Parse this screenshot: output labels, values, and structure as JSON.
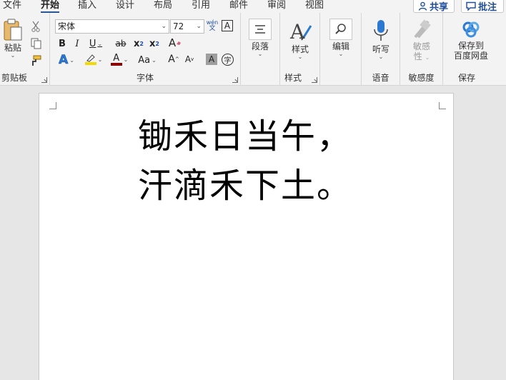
{
  "menu": {
    "tabs": [
      "文件",
      "开始",
      "插入",
      "设计",
      "布局",
      "引用",
      "邮件",
      "审阅",
      "视图"
    ],
    "share_label": "共享",
    "comment_label": "批注"
  },
  "ribbon": {
    "clipboard": {
      "paste_label": "粘贴",
      "group_label": "剪贴板"
    },
    "font": {
      "font_name": "宋体",
      "font_size": "72",
      "phonetic_top": "wén",
      "phonetic_bottom": "文",
      "border_char": "A",
      "clear_char": "A",
      "bold": "B",
      "italic": "I",
      "underline": "U",
      "strike": "ab",
      "subscript": "x",
      "subscript_mark": "2",
      "superscript": "x",
      "superscript_mark": "2",
      "text_effect": "A",
      "font_color": "A",
      "change_case": "Aa",
      "grow": "A",
      "shrink": "A",
      "shading": "A",
      "enclose": "字",
      "group_label": "字体"
    },
    "paragraph": {
      "label": "段落"
    },
    "styles": {
      "label": "样式",
      "group_label": "样式"
    },
    "editing": {
      "label": "编辑"
    },
    "voice": {
      "dictate_label": "听写",
      "group_label": "语音"
    },
    "sensitivity": {
      "label_line1": "敏感",
      "label_line2": "性",
      "group_label": "敏感度"
    },
    "save": {
      "label_line1": "保存到",
      "label_line2": "百度网盘",
      "group_label": "保存"
    }
  },
  "document": {
    "lines": [
      "锄禾日当午，",
      "汗滴禾下土。"
    ]
  },
  "colors": {
    "accent": "#2b5797",
    "highlight": "#f5d800",
    "font_color": "#c00000"
  }
}
